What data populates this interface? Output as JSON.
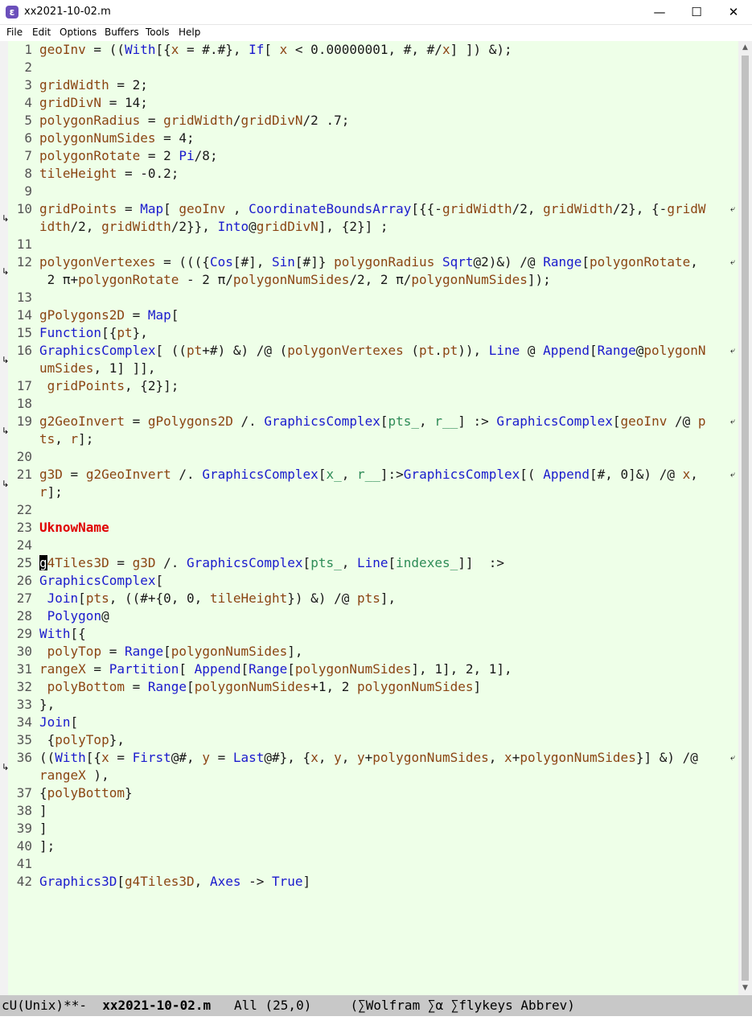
{
  "window": {
    "title": "xx2021-10-02.m",
    "icon": "emacs-icon",
    "minimize": "—",
    "maximize": "☐",
    "close": "✕"
  },
  "menu": [
    "File",
    "Edit",
    "Options",
    "Buffers",
    "Tools",
    "Help"
  ],
  "colors": {
    "editor_bg": "#eeffe8",
    "builtin": "#1a1acd",
    "symbol": "#8b4513",
    "pattern": "#2e8b57",
    "unknown": "#e00000",
    "text": "#1a1a1a"
  },
  "lines": [
    {
      "n": "1",
      "segs": [
        [
          "geoInv",
          "sym"
        ],
        [
          " = ((",
          ""
        ],
        [
          "With",
          "fn"
        ],
        [
          "[{",
          ""
        ],
        [
          "x",
          "sym"
        ],
        [
          " = #.#}, ",
          ""
        ],
        [
          "If",
          "fn"
        ],
        [
          "[ ",
          ""
        ],
        [
          "x",
          "sym"
        ],
        [
          " < 0.00000001, #, #/",
          ""
        ],
        [
          "x",
          "sym"
        ],
        [
          "] ]) &);",
          ""
        ]
      ]
    },
    {
      "n": "2",
      "segs": []
    },
    {
      "n": "3",
      "segs": [
        [
          "gridWidth",
          "sym"
        ],
        [
          " = 2;",
          ""
        ]
      ]
    },
    {
      "n": "4",
      "segs": [
        [
          "gridDivN",
          "sym"
        ],
        [
          " = 14;",
          ""
        ]
      ]
    },
    {
      "n": "5",
      "segs": [
        [
          "polygonRadius",
          "sym"
        ],
        [
          " = ",
          ""
        ],
        [
          "gridWidth",
          "sym"
        ],
        [
          "/",
          ""
        ],
        [
          "gridDivN",
          "sym"
        ],
        [
          "/2 .7;",
          ""
        ]
      ]
    },
    {
      "n": "6",
      "segs": [
        [
          "polygonNumSides",
          "sym"
        ],
        [
          " = 4;",
          ""
        ]
      ]
    },
    {
      "n": "7",
      "segs": [
        [
          "polygonRotate",
          "sym"
        ],
        [
          " = 2 ",
          ""
        ],
        [
          "Pi",
          "fn"
        ],
        [
          "/8;",
          ""
        ]
      ]
    },
    {
      "n": "8",
      "segs": [
        [
          "tileHeight",
          "sym"
        ],
        [
          " = -0.2;",
          ""
        ]
      ]
    },
    {
      "n": "9",
      "segs": []
    },
    {
      "n": "10",
      "wrap": true,
      "segs": [
        [
          "gridPoints",
          "sym"
        ],
        [
          " = ",
          ""
        ],
        [
          "Map",
          "fn"
        ],
        [
          "[ ",
          ""
        ],
        [
          "geoInv",
          "sym"
        ],
        [
          " , ",
          ""
        ],
        [
          "CoordinateBoundsArray",
          "fn"
        ],
        [
          "[{{-",
          ""
        ],
        [
          "gridWidth",
          "sym"
        ],
        [
          "/2, ",
          ""
        ],
        [
          "gridWidth",
          "sym"
        ],
        [
          "/2}, {-",
          ""
        ],
        [
          "gridW",
          "sym"
        ]
      ]
    },
    {
      "n": "",
      "segs": [
        [
          "idth",
          "sym"
        ],
        [
          "/2, ",
          ""
        ],
        [
          "gridWidth",
          "sym"
        ],
        [
          "/2}}, ",
          ""
        ],
        [
          "Into",
          "fn"
        ],
        [
          "@",
          ""
        ],
        [
          "gridDivN",
          "sym"
        ],
        [
          "], {2}] ;",
          ""
        ]
      ]
    },
    {
      "n": "11",
      "segs": []
    },
    {
      "n": "12",
      "wrap": true,
      "segs": [
        [
          "polygonVertexes",
          "sym"
        ],
        [
          " = ((({",
          ""
        ],
        [
          "Cos",
          "fn"
        ],
        [
          "[#], ",
          ""
        ],
        [
          "Sin",
          "fn"
        ],
        [
          "[#]} ",
          ""
        ],
        [
          "polygonRadius",
          "sym"
        ],
        [
          " ",
          ""
        ],
        [
          "Sqrt",
          "fn"
        ],
        [
          "@2)&) /@ ",
          ""
        ],
        [
          "Range",
          "fn"
        ],
        [
          "[",
          ""
        ],
        [
          "polygonRotate",
          "sym"
        ],
        [
          ",",
          ""
        ]
      ]
    },
    {
      "n": "",
      "segs": [
        [
          " 2 π+",
          ""
        ],
        [
          "polygonRotate",
          "sym"
        ],
        [
          " - 2 π/",
          ""
        ],
        [
          "polygonNumSides",
          "sym"
        ],
        [
          "/2, 2 π/",
          ""
        ],
        [
          "polygonNumSides",
          "sym"
        ],
        [
          "]);",
          ""
        ]
      ]
    },
    {
      "n": "13",
      "segs": []
    },
    {
      "n": "14",
      "segs": [
        [
          "gPolygons2D",
          "sym"
        ],
        [
          " = ",
          ""
        ],
        [
          "Map",
          "fn"
        ],
        [
          "[",
          ""
        ]
      ]
    },
    {
      "n": "15",
      "segs": [
        [
          "Function",
          "fn"
        ],
        [
          "[{",
          ""
        ],
        [
          "pt",
          "sym"
        ],
        [
          "},",
          ""
        ]
      ]
    },
    {
      "n": "16",
      "wrap": true,
      "segs": [
        [
          "GraphicsComplex",
          "fn"
        ],
        [
          "[ ((",
          ""
        ],
        [
          "pt",
          "sym"
        ],
        [
          "+#) &) /@ (",
          ""
        ],
        [
          "polygonVertexes",
          "sym"
        ],
        [
          " (",
          ""
        ],
        [
          "pt",
          "sym"
        ],
        [
          ".",
          ""
        ],
        [
          "pt",
          "sym"
        ],
        [
          ")), ",
          ""
        ],
        [
          "Line",
          "fn"
        ],
        [
          " @ ",
          ""
        ],
        [
          "Append",
          "fn"
        ],
        [
          "[",
          ""
        ],
        [
          "Range",
          "fn"
        ],
        [
          "@",
          ""
        ],
        [
          "polygonN",
          "sym"
        ]
      ]
    },
    {
      "n": "",
      "segs": [
        [
          "umSides",
          "sym"
        ],
        [
          ", 1] ]],",
          ""
        ]
      ]
    },
    {
      "n": "17",
      "segs": [
        [
          " ",
          ""
        ],
        [
          "gridPoints",
          "sym"
        ],
        [
          ", {2}];",
          ""
        ]
      ]
    },
    {
      "n": "18",
      "segs": []
    },
    {
      "n": "19",
      "wrap": true,
      "segs": [
        [
          "g2GeoInvert",
          "sym"
        ],
        [
          " = ",
          ""
        ],
        [
          "gPolygons2D",
          "sym"
        ],
        [
          " /. ",
          ""
        ],
        [
          "GraphicsComplex",
          "fn"
        ],
        [
          "[",
          ""
        ],
        [
          "pts_",
          "pat"
        ],
        [
          ", ",
          ""
        ],
        [
          "r__",
          "pat"
        ],
        [
          "] :> ",
          ""
        ],
        [
          "GraphicsComplex",
          "fn"
        ],
        [
          "[",
          ""
        ],
        [
          "geoInv",
          "sym"
        ],
        [
          " /@ ",
          ""
        ],
        [
          "p",
          "sym"
        ]
      ]
    },
    {
      "n": "",
      "segs": [
        [
          "ts",
          "sym"
        ],
        [
          ", ",
          ""
        ],
        [
          "r",
          "sym"
        ],
        [
          "];",
          ""
        ]
      ]
    },
    {
      "n": "20",
      "segs": []
    },
    {
      "n": "21",
      "wrap": true,
      "segs": [
        [
          "g3D",
          "sym"
        ],
        [
          " = ",
          ""
        ],
        [
          "g2GeoInvert",
          "sym"
        ],
        [
          " /. ",
          ""
        ],
        [
          "GraphicsComplex",
          "fn"
        ],
        [
          "[",
          ""
        ],
        [
          "x_",
          "pat"
        ],
        [
          ", ",
          ""
        ],
        [
          "r__",
          "pat"
        ],
        [
          "]:>",
          ""
        ],
        [
          "GraphicsComplex",
          "fn"
        ],
        [
          "[( ",
          ""
        ],
        [
          "Append",
          "fn"
        ],
        [
          "[#, 0]&) /@ ",
          ""
        ],
        [
          "x",
          "sym"
        ],
        [
          ", ",
          ""
        ]
      ]
    },
    {
      "n": "",
      "segs": [
        [
          "r",
          "sym"
        ],
        [
          "];",
          ""
        ]
      ]
    },
    {
      "n": "22",
      "segs": []
    },
    {
      "n": "23",
      "segs": [
        [
          "UknowName",
          "unk"
        ]
      ]
    },
    {
      "n": "24",
      "segs": []
    },
    {
      "n": "25",
      "segs": [
        [
          "g",
          "cur"
        ],
        [
          "4Tiles3D",
          "sym"
        ],
        [
          " = ",
          ""
        ],
        [
          "g3D",
          "sym"
        ],
        [
          " /. ",
          ""
        ],
        [
          "GraphicsComplex",
          "fn"
        ],
        [
          "[",
          ""
        ],
        [
          "pts_",
          "pat"
        ],
        [
          ", ",
          ""
        ],
        [
          "Line",
          "fn"
        ],
        [
          "[",
          ""
        ],
        [
          "indexes_",
          "pat"
        ],
        [
          "]]  :>",
          ""
        ]
      ]
    },
    {
      "n": "26",
      "segs": [
        [
          "GraphicsComplex",
          "fn"
        ],
        [
          "[",
          ""
        ]
      ]
    },
    {
      "n": "27",
      "segs": [
        [
          " ",
          ""
        ],
        [
          "Join",
          "fn"
        ],
        [
          "[",
          ""
        ],
        [
          "pts",
          "sym"
        ],
        [
          ", ((#+{0, 0, ",
          ""
        ],
        [
          "tileHeight",
          "sym"
        ],
        [
          "}) &) /@ ",
          ""
        ],
        [
          "pts",
          "sym"
        ],
        [
          "],",
          ""
        ]
      ]
    },
    {
      "n": "28",
      "segs": [
        [
          " ",
          ""
        ],
        [
          "Polygon",
          "fn"
        ],
        [
          "@",
          ""
        ]
      ]
    },
    {
      "n": "29",
      "segs": [
        [
          "With",
          "fn"
        ],
        [
          "[{",
          ""
        ]
      ]
    },
    {
      "n": "30",
      "segs": [
        [
          " ",
          ""
        ],
        [
          "polyTop",
          "sym"
        ],
        [
          " = ",
          ""
        ],
        [
          "Range",
          "fn"
        ],
        [
          "[",
          ""
        ],
        [
          "polygonNumSides",
          "sym"
        ],
        [
          "],",
          ""
        ]
      ]
    },
    {
      "n": "31",
      "segs": [
        [
          "rangeX",
          "sym"
        ],
        [
          " = ",
          ""
        ],
        [
          "Partition",
          "fn"
        ],
        [
          "[ ",
          ""
        ],
        [
          "Append",
          "fn"
        ],
        [
          "[",
          ""
        ],
        [
          "Range",
          "fn"
        ],
        [
          "[",
          ""
        ],
        [
          "polygonNumSides",
          "sym"
        ],
        [
          "], 1], 2, 1],",
          ""
        ]
      ]
    },
    {
      "n": "32",
      "segs": [
        [
          " ",
          ""
        ],
        [
          "polyBottom",
          "sym"
        ],
        [
          " = ",
          ""
        ],
        [
          "Range",
          "fn"
        ],
        [
          "[",
          ""
        ],
        [
          "polygonNumSides",
          "sym"
        ],
        [
          "+1, 2 ",
          ""
        ],
        [
          "polygonNumSides",
          "sym"
        ],
        [
          "]",
          ""
        ]
      ]
    },
    {
      "n": "33",
      "segs": [
        [
          "},",
          ""
        ]
      ]
    },
    {
      "n": "34",
      "segs": [
        [
          "Join",
          "fn"
        ],
        [
          "[",
          ""
        ]
      ]
    },
    {
      "n": "35",
      "segs": [
        [
          " {",
          ""
        ],
        [
          "polyTop",
          "sym"
        ],
        [
          "},",
          ""
        ]
      ]
    },
    {
      "n": "36",
      "wrap": true,
      "segs": [
        [
          "((",
          ""
        ],
        [
          "With",
          "fn"
        ],
        [
          "[{",
          ""
        ],
        [
          "x",
          "sym"
        ],
        [
          " = ",
          ""
        ],
        [
          "First",
          "fn"
        ],
        [
          "@#, ",
          ""
        ],
        [
          "y",
          "sym"
        ],
        [
          " = ",
          ""
        ],
        [
          "Last",
          "fn"
        ],
        [
          "@#}, {",
          ""
        ],
        [
          "x",
          "sym"
        ],
        [
          ", ",
          ""
        ],
        [
          "y",
          "sym"
        ],
        [
          ", ",
          ""
        ],
        [
          "y",
          "sym"
        ],
        [
          "+",
          ""
        ],
        [
          "polygonNumSides",
          "sym"
        ],
        [
          ", ",
          ""
        ],
        [
          "x",
          "sym"
        ],
        [
          "+",
          ""
        ],
        [
          "polygonNumSides",
          "sym"
        ],
        [
          "}] &) /@",
          ""
        ]
      ]
    },
    {
      "n": "",
      "segs": [
        [
          "rangeX",
          "sym"
        ],
        [
          " ),",
          ""
        ]
      ]
    },
    {
      "n": "37",
      "segs": [
        [
          "{",
          ""
        ],
        [
          "polyBottom",
          "sym"
        ],
        [
          "}",
          ""
        ]
      ]
    },
    {
      "n": "38",
      "segs": [
        [
          "]",
          ""
        ]
      ]
    },
    {
      "n": "39",
      "segs": [
        [
          "]",
          ""
        ]
      ]
    },
    {
      "n": "40",
      "segs": [
        [
          "];",
          ""
        ]
      ]
    },
    {
      "n": "41",
      "segs": []
    },
    {
      "n": "42",
      "segs": [
        [
          "Graphics3D",
          "fn"
        ],
        [
          "[",
          ""
        ],
        [
          "g4Tiles3D",
          "sym"
        ],
        [
          ", ",
          ""
        ],
        [
          "Axes",
          "fn"
        ],
        [
          " -> ",
          ""
        ],
        [
          "True",
          "fn"
        ],
        [
          "]",
          ""
        ]
      ]
    }
  ],
  "modeline": {
    "encoding": "cU(Unix)**-",
    "buffer": "xx2021-10-02.m",
    "position": "All (25,0)",
    "modes": "(∑Wolfram ∑α ∑flykeys Abbrev)"
  }
}
